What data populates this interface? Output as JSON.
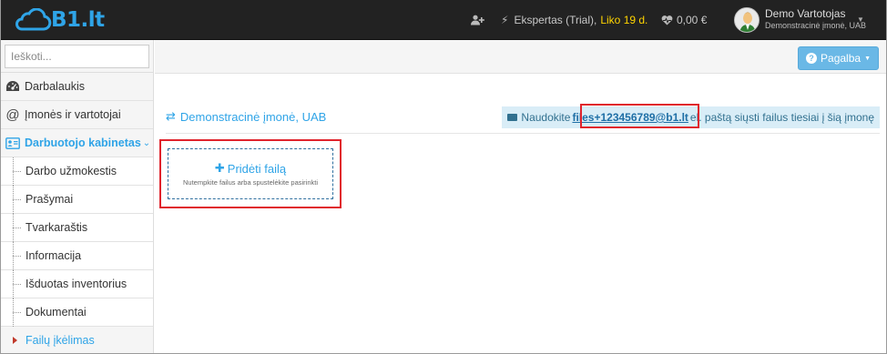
{
  "brand": {
    "logo_text": "B1.lt",
    "accent": "#2fa4e7"
  },
  "navbar": {
    "add_user_icon": "user-plus-icon",
    "plan_label": "Ekspertas (Trial),",
    "trial_left": "Liko 19 d.",
    "balance": "0,00 €",
    "user_name": "Demo Vartotojas",
    "user_company": "Demonstracinė įmonė, UAB"
  },
  "sidebar": {
    "search_placeholder": "Ieškoti...",
    "items": [
      {
        "label": "Darbalaukis",
        "icon": "dashboard-icon"
      },
      {
        "label": "Įmonės ir vartotojai",
        "icon": "at-icon"
      },
      {
        "label": "Darbuotojo kabinetas",
        "icon": "id-card-icon"
      }
    ],
    "subitems": [
      {
        "label": "Darbo užmokestis"
      },
      {
        "label": "Prašymai"
      },
      {
        "label": "Tvarkaraštis"
      },
      {
        "label": "Informacija"
      },
      {
        "label": "Išduotas inventorius"
      },
      {
        "label": "Dokumentai"
      },
      {
        "label": "Failų įkėlimas"
      }
    ]
  },
  "header": {
    "help_label": "Pagalba"
  },
  "main": {
    "company_name": "Demonstracinė įmonė, UAB",
    "email_note_prefix": "Naudokite",
    "email_address": "files+123456789@b1.lt",
    "email_note_suffix": "el. paštą siųsti failus tiesiai į šią įmonę",
    "dropzone_title": "Pridėti failą",
    "dropzone_hint": "Nutempkite failus arba spustelėkite pasirinkti"
  }
}
